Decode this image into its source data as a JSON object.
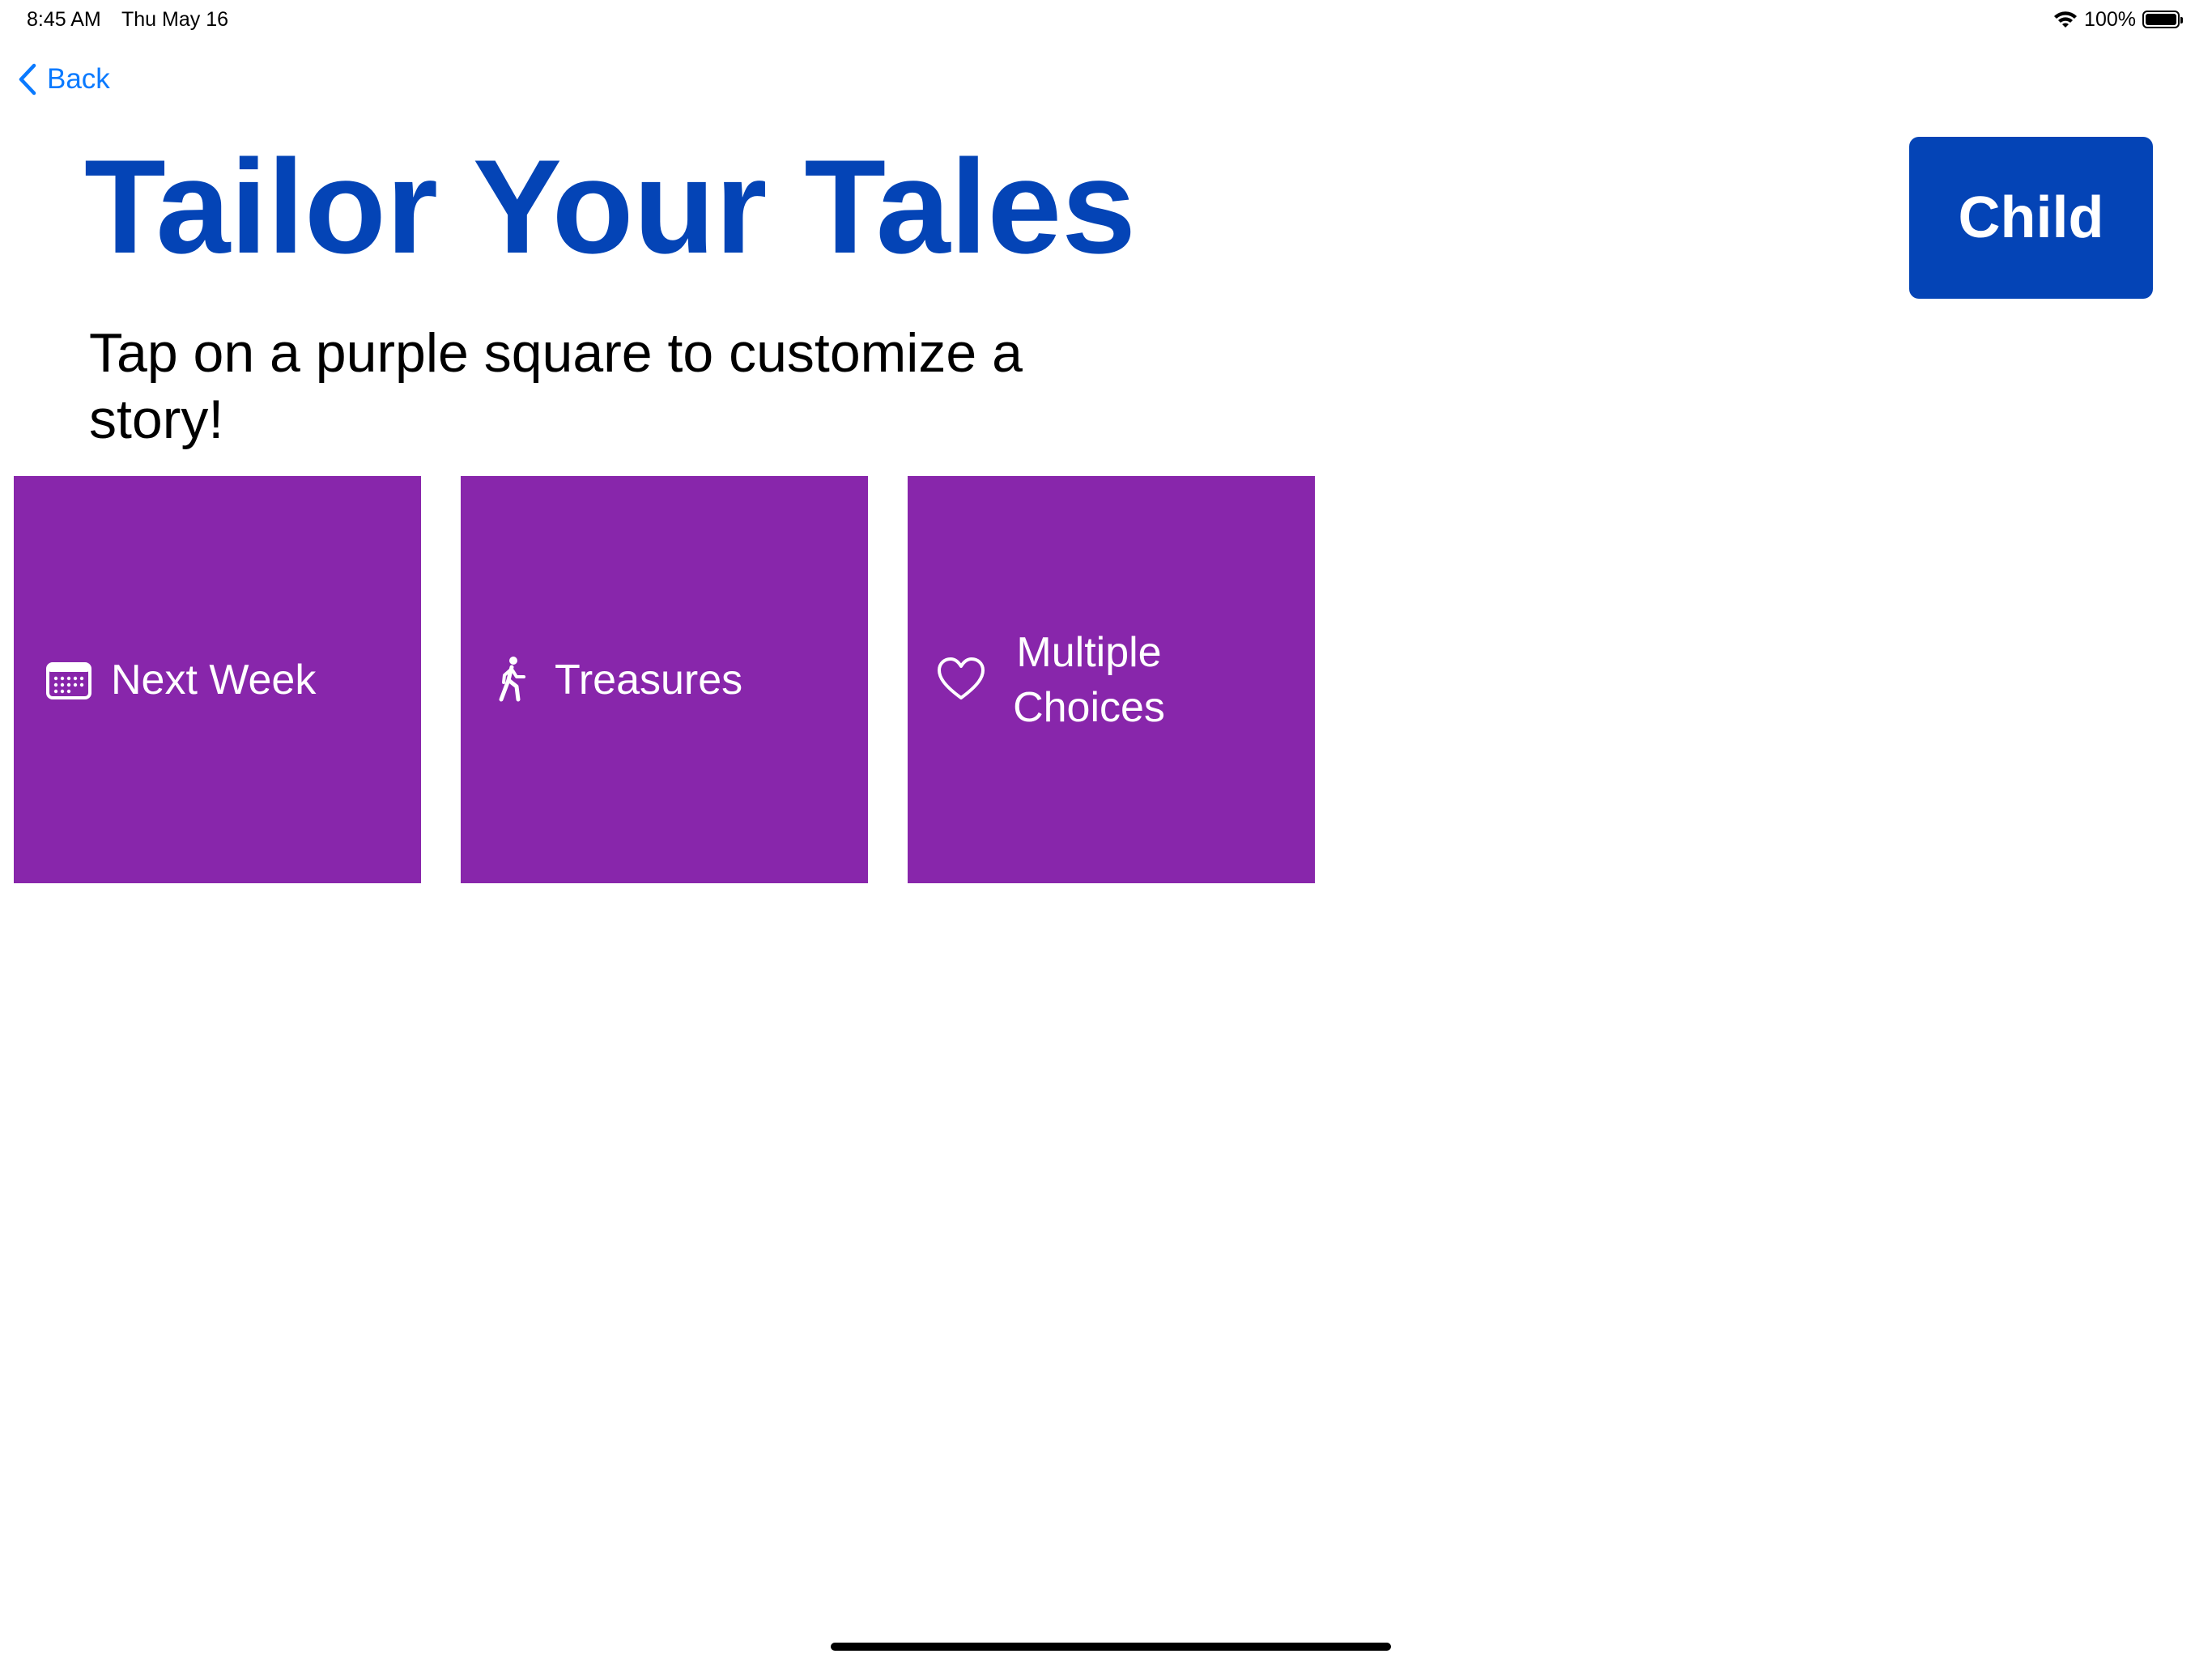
{
  "status_bar": {
    "time": "8:45 AM",
    "date": "Thu May 16",
    "battery_percent": "100%",
    "battery_level": 1.0
  },
  "nav": {
    "back_label": "Back",
    "back_icon": "chevron-left-icon"
  },
  "header": {
    "title": "Tailor Your Tales",
    "mode_button_label": "Child"
  },
  "instructions": "Tap on a purple square to customize a story!",
  "tiles": [
    {
      "label": "Next Week",
      "icon": "calendar-icon"
    },
    {
      "label": "Treasures",
      "icon": "walking-person-icon"
    },
    {
      "label": "Multiple Choices",
      "icon": "heart-icon"
    }
  ],
  "colors": {
    "title_blue": "#0444b6",
    "tile_purple": "#8826ab",
    "link_blue": "#0a7aff"
  }
}
